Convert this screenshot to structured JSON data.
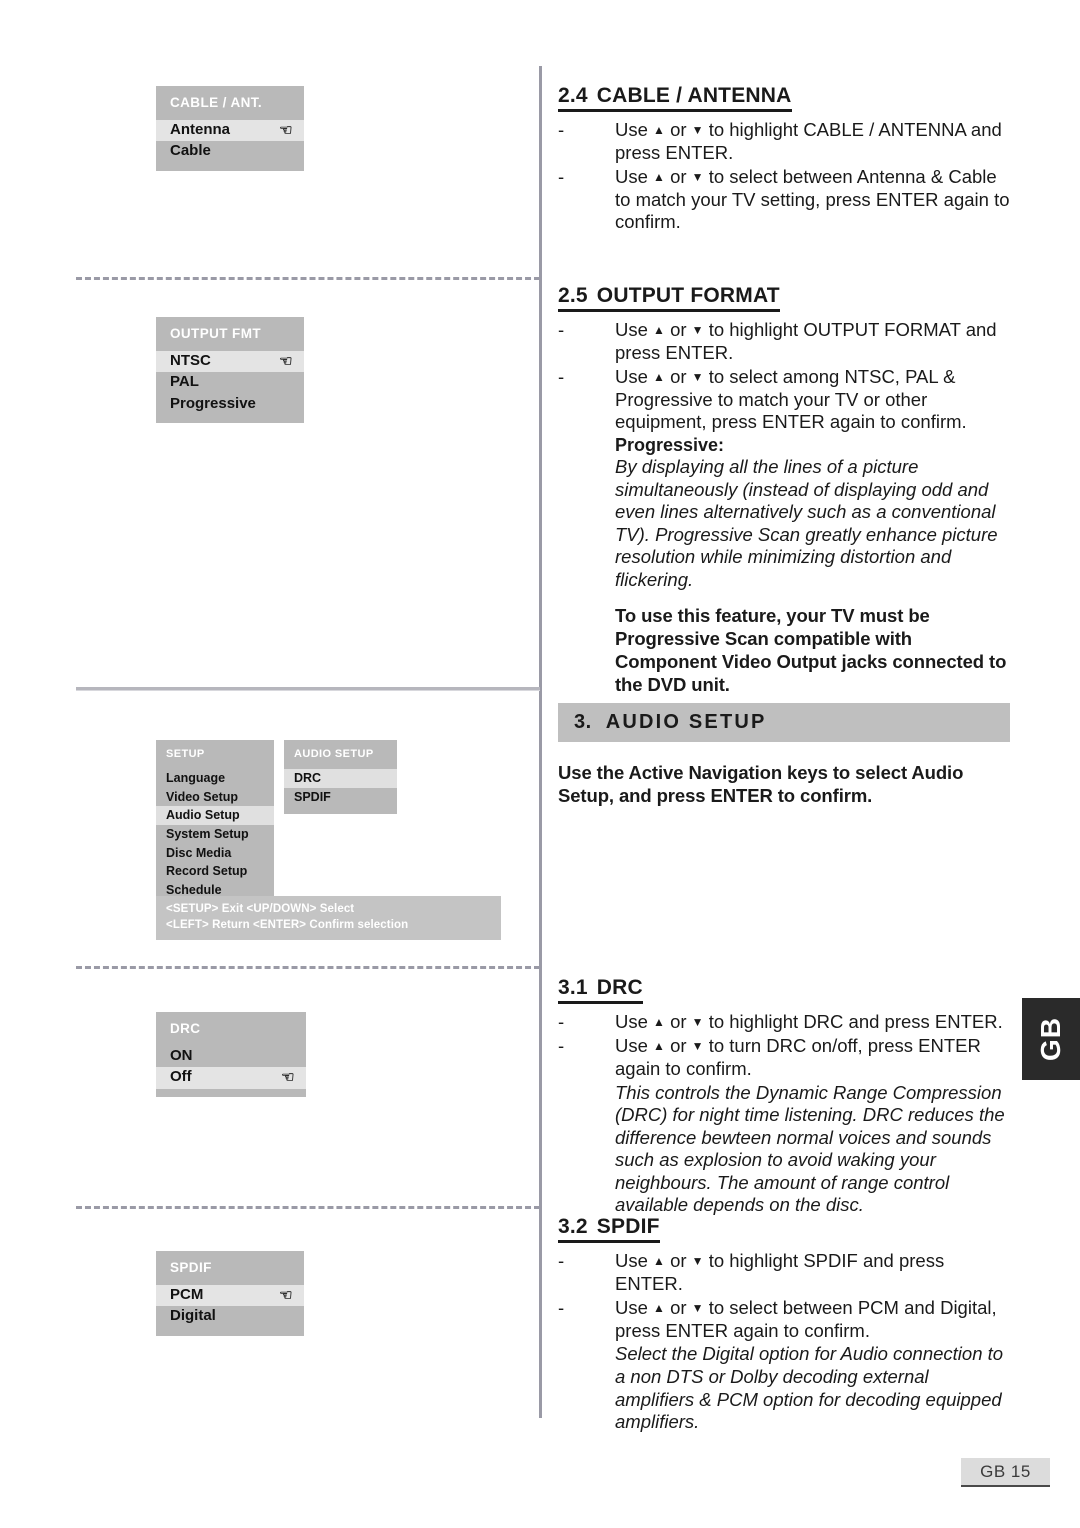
{
  "osd_panels": {
    "cable_ant": {
      "title": "CABLE / ANT.",
      "items": [
        {
          "label": "Antenna",
          "selected": true
        },
        {
          "label": "Cable",
          "selected": false
        }
      ]
    },
    "output_fmt": {
      "title": "OUTPUT FMT",
      "items": [
        {
          "label": "NTSC",
          "selected": true
        },
        {
          "label": "PAL",
          "selected": false
        },
        {
          "label": "Progressive",
          "selected": false
        }
      ]
    },
    "drc": {
      "title": "DRC",
      "items": [
        {
          "label": "ON",
          "selected": false
        },
        {
          "label": "Off",
          "selected": true
        }
      ]
    },
    "spdif": {
      "title": "SPDIF",
      "items": [
        {
          "label": "PCM",
          "selected": true
        },
        {
          "label": "Digital",
          "selected": false
        }
      ]
    },
    "setup_menu": {
      "title": "SETUP",
      "items": [
        {
          "label": "Language",
          "selected": false
        },
        {
          "label": "Video Setup",
          "selected": false
        },
        {
          "label": "Audio Setup",
          "selected": true
        },
        {
          "label": "System Setup",
          "selected": false
        },
        {
          "label": "Disc Media",
          "selected": false
        },
        {
          "label": "Record Setup",
          "selected": false
        },
        {
          "label": "Schedule",
          "selected": false
        }
      ]
    },
    "audio_setup_menu": {
      "title": "AUDIO SETUP",
      "items": [
        {
          "label": "DRC",
          "selected": true
        },
        {
          "label": "SPDIF",
          "selected": false
        }
      ]
    },
    "hint_bar": {
      "line1": "<SETUP> Exit   <UP/DOWN> Select",
      "line2": "<LEFT> Return  <ENTER> Confirm selection"
    },
    "pointer_icon": "☞"
  },
  "sections": {
    "cable_antenna": {
      "number": "2.4",
      "title": "CABLE / ANTENNA",
      "bullets": [
        {
          "pre": "Use ",
          "up": "▲",
          "mid": " or ",
          "down": "▼",
          "post": " to highlight CABLE / ANTENNA and press ENTER."
        },
        {
          "pre": "Use ",
          "up": "▲",
          "mid": " or ",
          "down": "▼",
          "post": " to select  between Antenna  &  Cable to match your TV setting, press ENTER again to confirm."
        }
      ]
    },
    "output_format": {
      "number": "2.5",
      "title": "OUTPUT FORMAT",
      "bullets": [
        {
          "pre": "Use ",
          "up": "▲",
          "mid": " or ",
          "down": "▼",
          "post": " to highlight OUTPUT FORMAT and press ENTER."
        },
        {
          "pre": "Use ",
          "up": "▲",
          "mid": " or ",
          "down": "▼",
          "post": " to select among NTSC, PAL & Progressive to match your TV or other equipment, press ENTER again to confirm."
        }
      ],
      "progressive_label": "Progressive:",
      "progressive_italic": "By displaying all the lines of a picture simultaneously (instead of displaying odd and even lines alternatively such as a conventional TV). Progressive Scan greatly enhance picture resolution while minimizing distortion and flickering.",
      "progressive_warning": "To use this feature, your TV must be Progressive Scan compatible with Component Video Output jacks connected to the DVD unit."
    },
    "audio_setup": {
      "number": "3.",
      "title": "AUDIO SETUP",
      "intro": "Use the Active Navigation keys to select Audio Setup, and press ENTER to confirm."
    },
    "drc": {
      "number": "3.1",
      "title": "DRC",
      "bullets": [
        {
          "pre": "Use ",
          "up": "▲",
          "mid": " or ",
          "down": "▼",
          "post": " to highlight DRC and press ENTER."
        },
        {
          "pre": "Use ",
          "up": "▲",
          "mid": " or ",
          "down": "▼",
          "post": " to turn DRC on/off, press ENTER again to confirm."
        }
      ],
      "note_italic": "This controls the Dynamic Range Compression (DRC) for night time listening. DRC reduces the difference bewteen normal voices and sounds such as explosion to avoid waking your neighbours. The amount of range control available depends on the disc."
    },
    "spdif": {
      "number": "3.2",
      "title": "SPDIF",
      "bullets": [
        {
          "pre": "Use ",
          "up": "▲",
          "mid": " or ",
          "down": "▼",
          "post": " to highlight SPDIF and press ENTER."
        },
        {
          "pre": "Use ",
          "up": "▲",
          "mid": " or ",
          "down": "▼",
          "post": " to select between PCM and Digital, press ENTER again to confirm."
        }
      ],
      "note_italic": "Select the Digital option for Audio connection to a non DTS or Dolby decoding external amplifiers & PCM option for decoding equipped amplifiers."
    }
  },
  "side_tab": "GB",
  "page_footer": "GB 15"
}
